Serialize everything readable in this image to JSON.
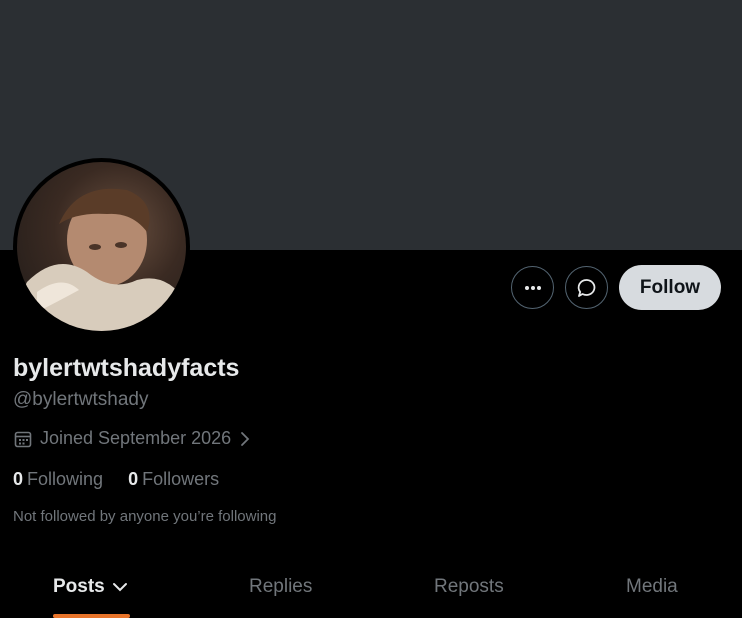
{
  "profile": {
    "display_name": "bylertwtshadyfacts",
    "handle": "@bylertwtshady",
    "joined": "Joined September 2026",
    "not_followed": "Not followed by anyone you’re following"
  },
  "stats": {
    "following_count": "0",
    "following_label": "Following",
    "followers_count": "0",
    "followers_label": "Followers"
  },
  "actions": {
    "follow_label": "Follow",
    "more_icon": "more-horizontal-icon",
    "message_icon": "message-bubble-icon"
  },
  "tabs": [
    {
      "label": "Posts",
      "active": true
    },
    {
      "label": "Replies",
      "active": false
    },
    {
      "label": "Reposts",
      "active": false
    },
    {
      "label": "Media",
      "active": false
    }
  ],
  "colors": {
    "banner": "#2b2f33",
    "background": "#000000",
    "muted_text": "#71767b",
    "tab_indicator": "#e8742a",
    "follow_button": "#d7dbdf"
  }
}
